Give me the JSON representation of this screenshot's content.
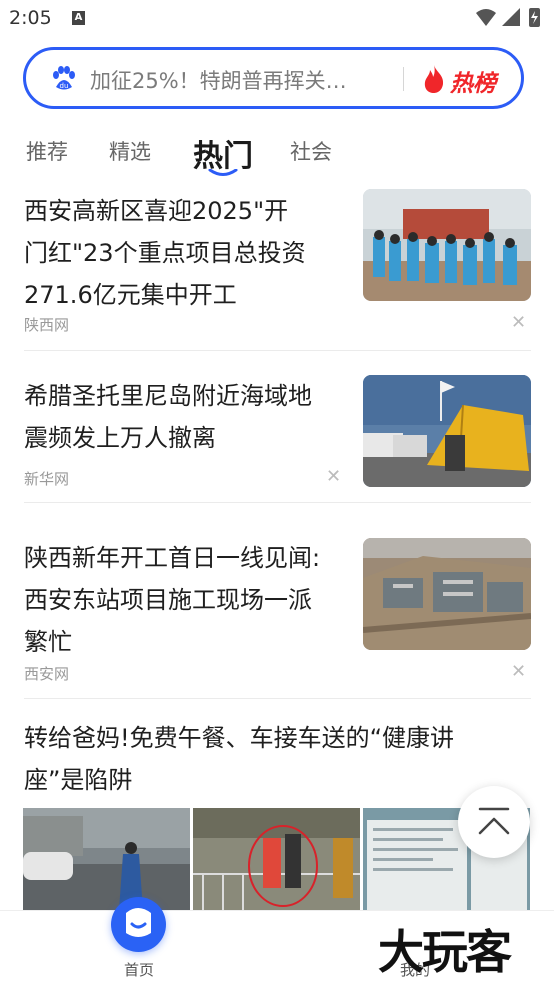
{
  "status_bar": {
    "time": "2:05",
    "notif_letter": "A"
  },
  "search": {
    "query": "加征25%！特朗普再挥关…",
    "hot_label": "热榜"
  },
  "tabs": [
    {
      "label": "推荐"
    },
    {
      "label": "精选"
    },
    {
      "label": "热门",
      "active": true
    },
    {
      "label": "社会"
    }
  ],
  "articles": [
    {
      "title_lines": [
        "西安高新区喜迎2025\"开",
        "门红\"23个重点项目总投资",
        "271.6亿元集中开工"
      ],
      "source": "陕西网"
    },
    {
      "title_lines": [
        "希腊圣托里尼岛附近海域地",
        "震频发上万人撤离"
      ],
      "source": "新华网"
    },
    {
      "title_lines": [
        "陕西新年开工首日一线见闻:",
        "西安东站项目施工现场一派",
        "繁忙"
      ],
      "source": "西安网"
    },
    {
      "title_lines": [
        "转给爸妈!免费午餐、车接车送的“健康讲",
        "座”是陷阱"
      ],
      "source": ""
    }
  ],
  "bottom_nav": {
    "home": "首页",
    "mine": "我的"
  },
  "watermark": "大玩客",
  "colors": {
    "accent": "#2c5cf6",
    "hot": "#f0262a"
  }
}
